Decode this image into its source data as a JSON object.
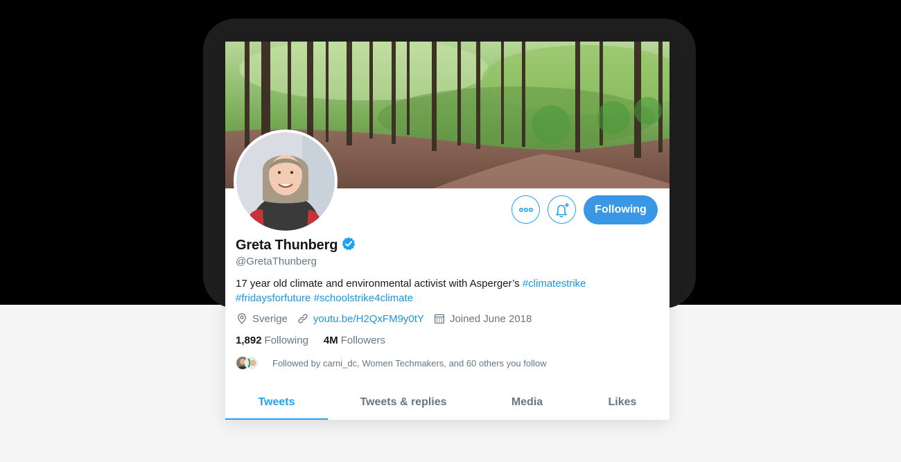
{
  "profile": {
    "name": "Greta Thunberg",
    "handle": "@GretaThunberg",
    "bio_text": "17 year old climate and environmental activist with Asperger’s ",
    "hashtags": [
      "#climatestrike",
      "#fridaysforfuture",
      "#schoolstrike4climate"
    ],
    "location": "Sverige",
    "website": "youtu.be/H2QxFM9y0tY",
    "joined": "Joined June 2018",
    "verified_icon": "verified-badge-icon"
  },
  "stats": {
    "following_count": "1,892",
    "following_label": "Following",
    "followers_count": "4M",
    "followers_label": "Followers"
  },
  "followed_by": "Followed by carni_dc, Women Techmakers, and 60 others you follow",
  "actions": {
    "more_icon": "more-icon",
    "bell_icon": "bell-plus-icon",
    "following_button": "Following"
  },
  "tabs": [
    {
      "label": "Tweets",
      "active": true
    },
    {
      "label": "Tweets & replies",
      "active": false
    },
    {
      "label": "Media",
      "active": false
    },
    {
      "label": "Likes",
      "active": false
    }
  ],
  "colors": {
    "accent": "#1da1f2",
    "link": "#1b95e0",
    "follow_button_bg": "#3a97e6",
    "text_primary": "#14171a",
    "text_secondary": "#657786"
  }
}
